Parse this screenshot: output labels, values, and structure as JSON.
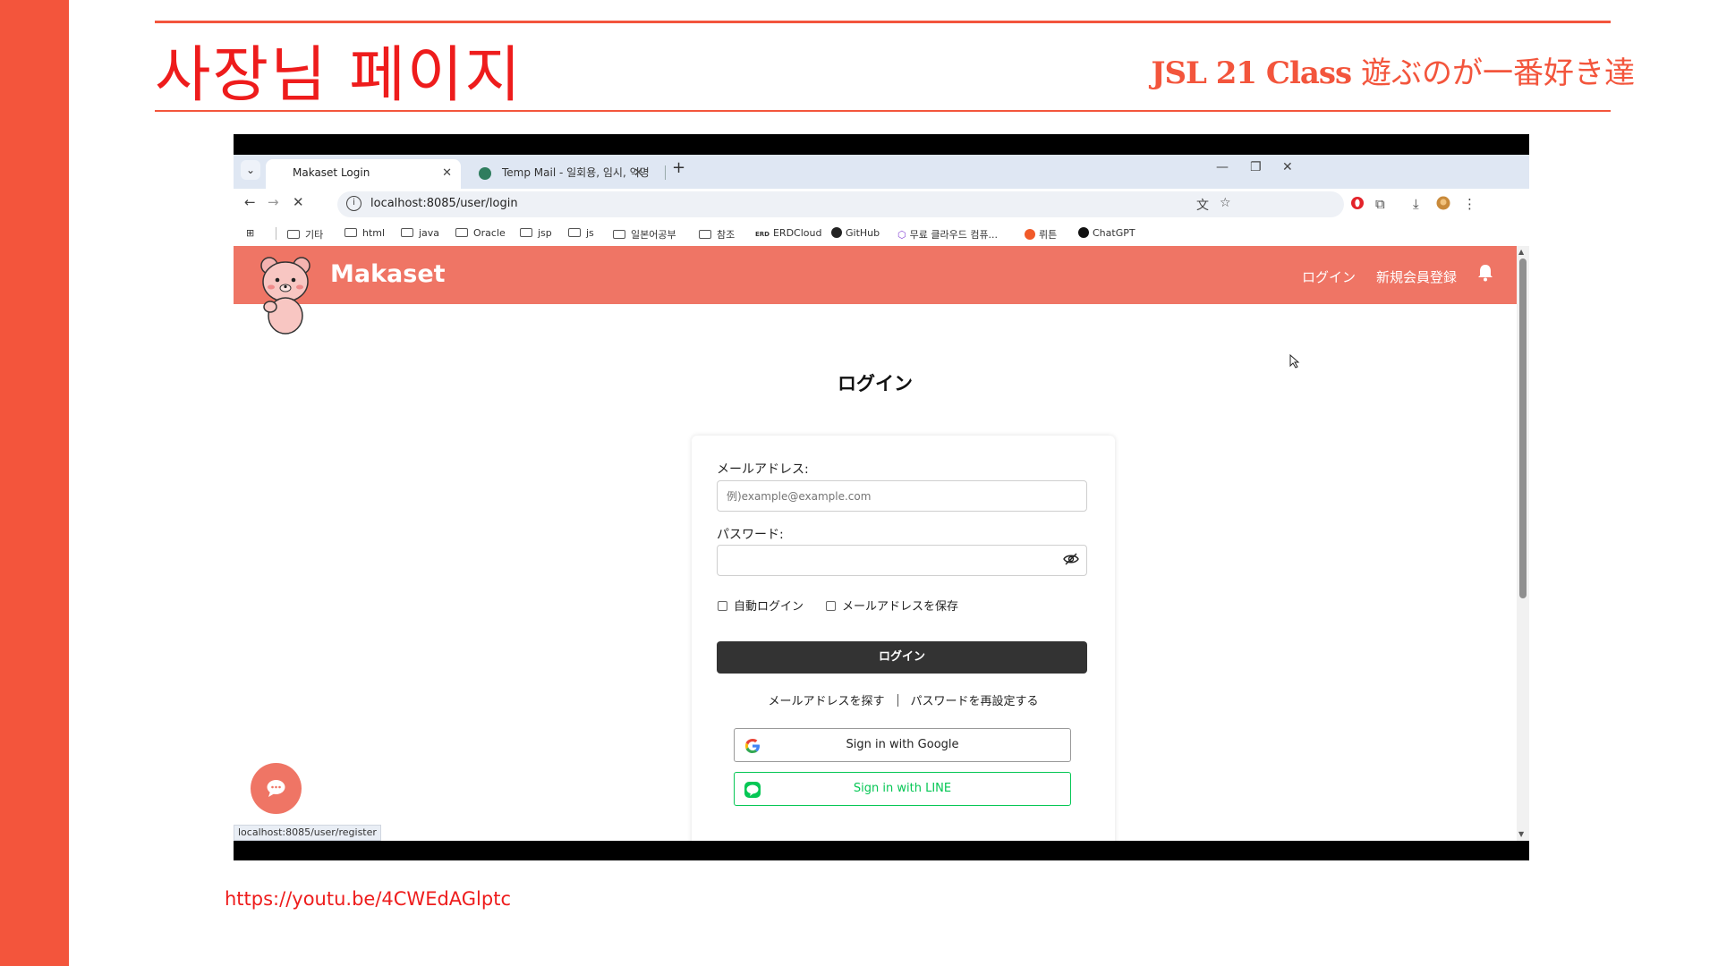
{
  "slide": {
    "title": "사장님 페이지",
    "subtitle_brand": "JSL 21 Class",
    "subtitle_jp": " 遊ぶのが一番好き達",
    "link": "https://youtu.be/4CWEdAGlptc"
  },
  "browser": {
    "tabs": [
      {
        "label": "Makaset Login",
        "close": "✕"
      },
      {
        "label": "Temp Mail - 일회용, 임시, 익명",
        "close": "✕"
      }
    ],
    "new_tab": "+",
    "window_controls": {
      "minimize": "—",
      "restore": "❐",
      "close": "✕"
    },
    "url": "localhost:8085/user/login",
    "bookmarks": [
      "기타",
      "html",
      "java",
      "Oracle",
      "jsp",
      "js",
      "일본어공부",
      "참조",
      "ERDCloud",
      "GitHub",
      "무료 클라우드 컴퓨...",
      "뤼튼",
      "ChatGPT"
    ],
    "status_url": "localhost:8085/user/register"
  },
  "site": {
    "brand": "Makaset",
    "nav_login": "ログイン",
    "nav_register": "新規会員登録",
    "login_title": "ログイン",
    "email_label": "メールアドレス:",
    "email_placeholder": "例)example@example.com",
    "email_value": "",
    "password_label": "パスワード:",
    "password_value": "",
    "auto_login": "自動ログイン",
    "save_email": "メールアドレスを保存",
    "login_button": "ログイン",
    "find_email": "メールアドレスを探す",
    "reset_password": "パスワードを再設定する",
    "google_button": "Sign in with Google",
    "line_button": "Sign in with LINE"
  },
  "colors": {
    "accent_red": "#f3553c",
    "header": "#ef7565",
    "line_green": "#06c755",
    "button_dark": "#333333"
  }
}
